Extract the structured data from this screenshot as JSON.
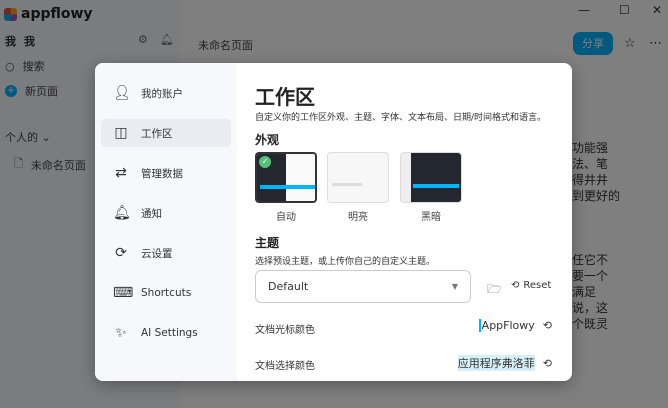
{
  "app": {
    "logo": "appflowy",
    "workspace_icon": "我",
    "workspace_name": "我",
    "search": "搜索",
    "new_page": "新页面",
    "section": "个人的 ⌄",
    "page": "未命名页面"
  },
  "header": {
    "doc_title": "未命名页面",
    "share": "分享"
  },
  "bg_text": {
    "block1": [
      "功能强",
      "法、笔",
      "得井井",
      "到更好的"
    ],
    "block2": [
      "任它不",
      "要一个",
      "满足",
      "说，这",
      "个既灵"
    ]
  },
  "dialog": {
    "nav": [
      {
        "label": "我的账户",
        "icon": "user-icon"
      },
      {
        "label": "工作区",
        "icon": "layout-icon"
      },
      {
        "label": "管理数据",
        "icon": "arrows-icon"
      },
      {
        "label": "通知",
        "icon": "bell-icon"
      },
      {
        "label": "云设置",
        "icon": "sync-icon"
      },
      {
        "label": "Shortcuts",
        "icon": "keyboard-icon"
      },
      {
        "label": "AI Settings",
        "icon": "magic-wand-icon"
      }
    ],
    "title": "工作区",
    "description": "自定义你的工作区外观、主题、字体、文本布局、日期/时间格式和语言。",
    "appearance_label": "外观",
    "themes": [
      {
        "label": "自动",
        "selected": true
      },
      {
        "label": "明亮",
        "selected": false
      },
      {
        "label": "黑暗",
        "selected": false
      }
    ],
    "theme_label": "主题",
    "theme_desc": "选择预设主题，或上传你自己的自定义主题。",
    "theme_value": "Default",
    "reset": "Reset",
    "cursor_color_label": "文档光标颜色",
    "cursor_color_value": "AppFlowy",
    "selection_color_label": "文档选择颜色",
    "selection_color_value": "应用程序弗洛菲"
  },
  "colors": {
    "accent": "#00b5ff"
  }
}
